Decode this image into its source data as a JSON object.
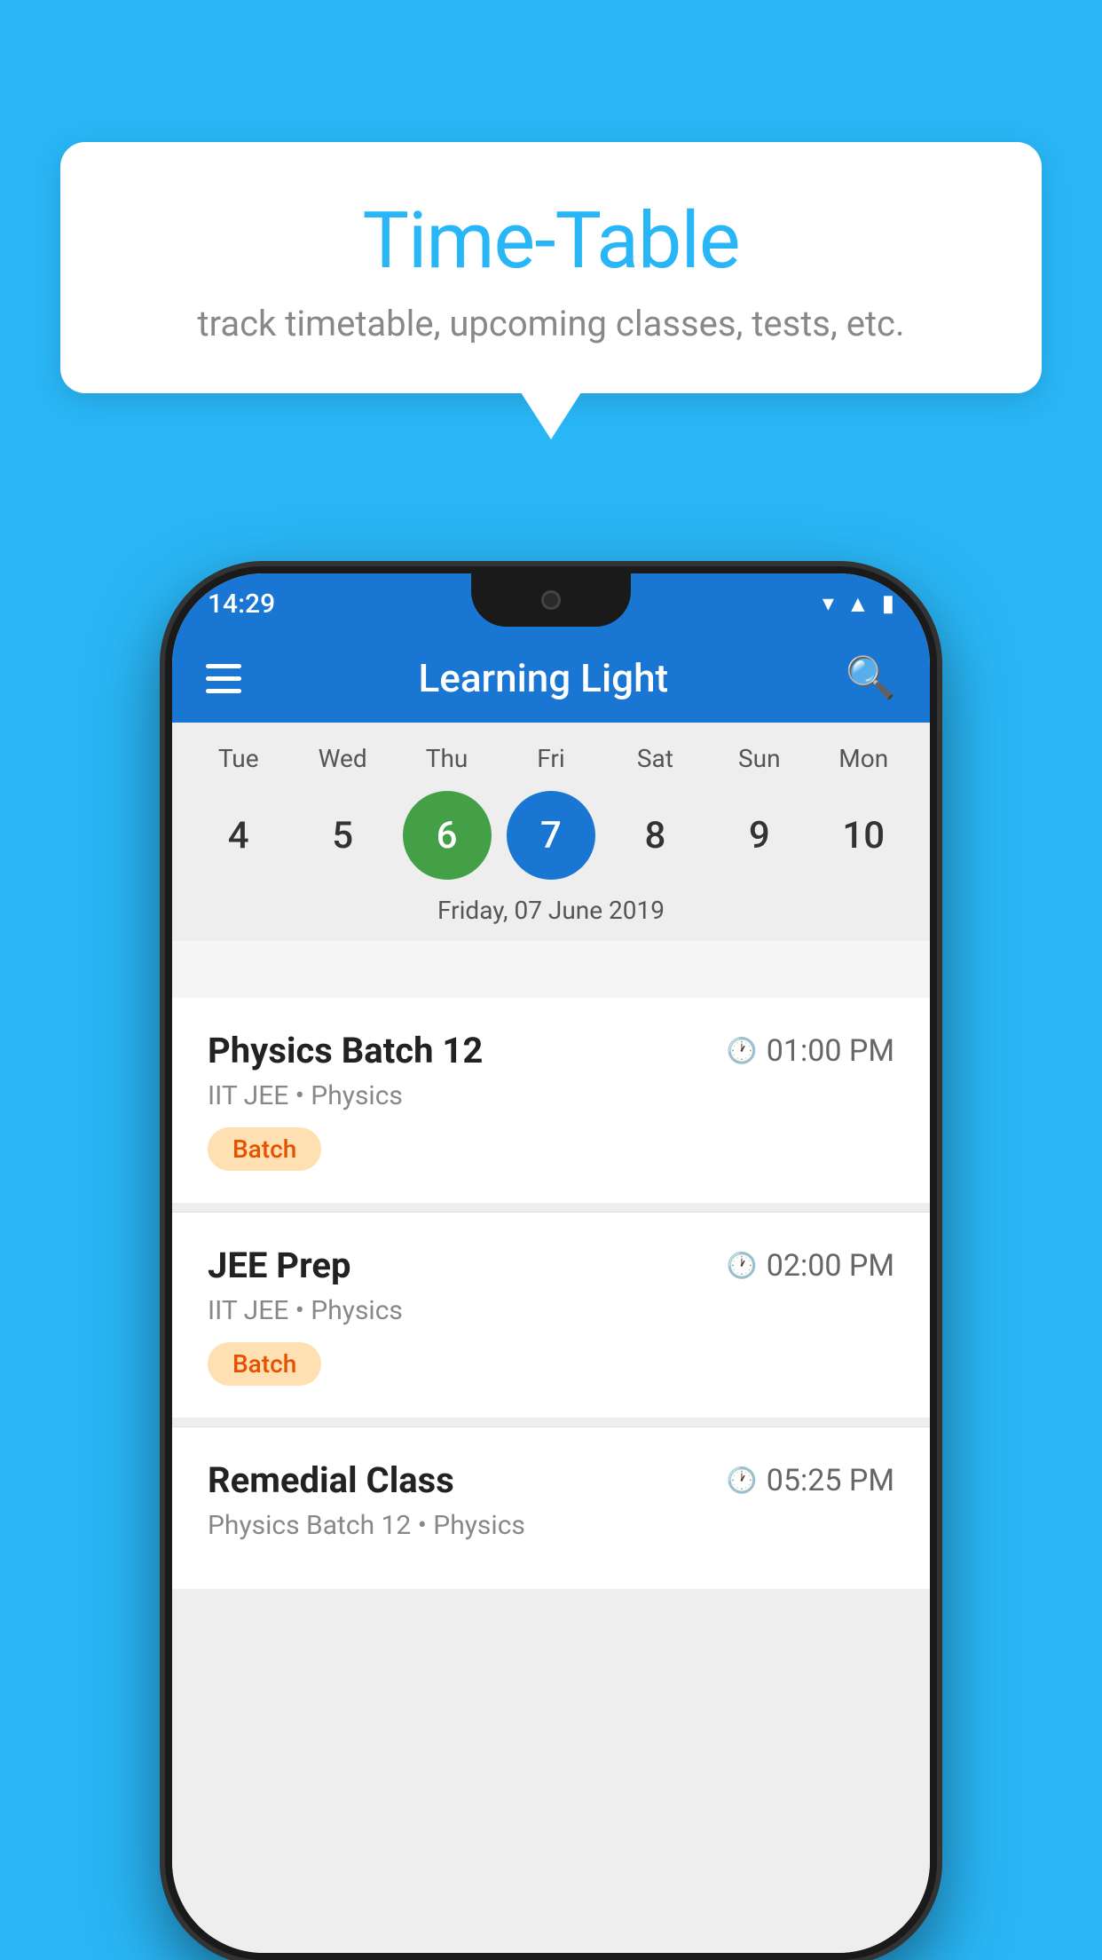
{
  "background_color": "#29b6f6",
  "tooltip": {
    "title": "Time-Table",
    "subtitle": "track timetable, upcoming classes, tests, etc."
  },
  "status_bar": {
    "time": "14:29"
  },
  "app_bar": {
    "title": "Learning Light"
  },
  "calendar": {
    "selected_date_label": "Friday, 07 June 2019",
    "days": [
      {
        "label": "Tue",
        "date": "4",
        "state": "normal"
      },
      {
        "label": "Wed",
        "date": "5",
        "state": "normal"
      },
      {
        "label": "Thu",
        "date": "6",
        "state": "today"
      },
      {
        "label": "Fri",
        "date": "7",
        "state": "selected"
      },
      {
        "label": "Sat",
        "date": "8",
        "state": "normal"
      },
      {
        "label": "Sun",
        "date": "9",
        "state": "normal"
      },
      {
        "label": "Mon",
        "date": "10",
        "state": "normal"
      }
    ]
  },
  "events": [
    {
      "name": "Physics Batch 12",
      "time": "01:00 PM",
      "sub": "IIT JEE • Physics",
      "badge": "Batch"
    },
    {
      "name": "JEE Prep",
      "time": "02:00 PM",
      "sub": "IIT JEE • Physics",
      "badge": "Batch"
    },
    {
      "name": "Remedial Class",
      "time": "05:25 PM",
      "sub": "Physics Batch 12 • Physics",
      "badge": ""
    }
  ],
  "icons": {
    "hamburger": "≡",
    "search": "🔍",
    "clock": "🕐"
  }
}
